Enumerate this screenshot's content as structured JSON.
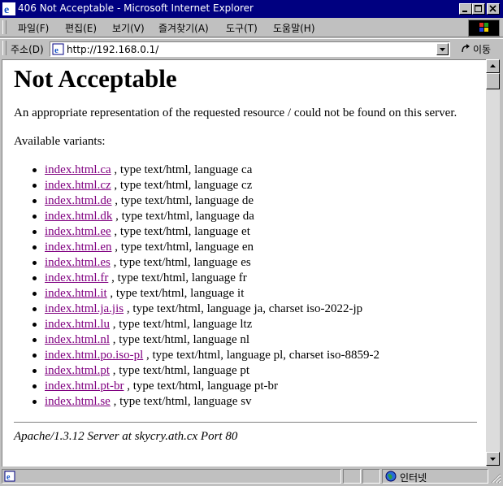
{
  "window": {
    "title": "406 Not Acceptable - Microsoft Internet Explorer"
  },
  "menu": {
    "items": [
      "파일(F)",
      "편집(E)",
      "보기(V)",
      "즐겨찾기(A)",
      "도구(T)",
      "도움말(H)"
    ]
  },
  "address_bar": {
    "label": "주소(D)",
    "url": "http://192.168.0.1/",
    "go_label": "이동"
  },
  "page": {
    "heading": "Not Acceptable",
    "message": "An appropriate representation of the requested resource / could not be found on this server.",
    "variants_label": "Available variants:",
    "variants": [
      {
        "link": "index.html.ca",
        "desc": ", type text/html, language ca"
      },
      {
        "link": "index.html.cz",
        "desc": ", type text/html, language cz"
      },
      {
        "link": "index.html.de",
        "desc": ", type text/html, language de"
      },
      {
        "link": "index.html.dk",
        "desc": ", type text/html, language da"
      },
      {
        "link": "index.html.ee",
        "desc": ", type text/html, language et"
      },
      {
        "link": "index.html.en",
        "desc": ", type text/html, language en"
      },
      {
        "link": "index.html.es",
        "desc": ", type text/html, language es"
      },
      {
        "link": "index.html.fr",
        "desc": ", type text/html, language fr"
      },
      {
        "link": "index.html.it",
        "desc": ", type text/html, language it"
      },
      {
        "link": "index.html.ja.jis",
        "desc": ", type text/html, language ja, charset iso-2022-jp"
      },
      {
        "link": "index.html.lu",
        "desc": ", type text/html, language ltz"
      },
      {
        "link": "index.html.nl",
        "desc": ", type text/html, language nl"
      },
      {
        "link": "index.html.po.iso-pl",
        "desc": ", type text/html, language pl, charset iso-8859-2"
      },
      {
        "link": "index.html.pt",
        "desc": ", type text/html, language pt"
      },
      {
        "link": "index.html.pt-br",
        "desc": ", type text/html, language pt-br"
      },
      {
        "link": "index.html.se",
        "desc": ", type text/html, language sv"
      }
    ],
    "footer": "Apache/1.3.12 Server at skycry.ath.cx Port 80"
  },
  "status": {
    "zone_label": "인터넷"
  },
  "colors": {
    "titlebar": "#000080",
    "chrome": "#c0c0c0",
    "visited_link": "#800080"
  }
}
